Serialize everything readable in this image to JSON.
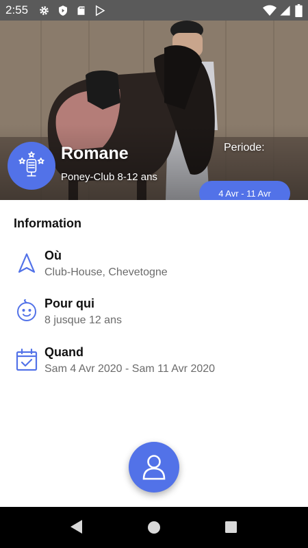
{
  "status_bar": {
    "time": "2:55",
    "left_icons": [
      "gear-icon",
      "shield-icon",
      "sd-card-icon",
      "play-store-icon"
    ],
    "right_icons": [
      "wifi-icon",
      "signal-icon",
      "battery-icon"
    ]
  },
  "hero": {
    "name": "Romane",
    "subtitle": "Poney-Club 8-12 ans",
    "periode_label": "Periode:",
    "periode_value": "4 Avr - 11 Avr",
    "avatar_icon": "award-mic-icon"
  },
  "information": {
    "title": "Information",
    "rows": [
      {
        "icon": "navigation-arrow-icon",
        "title": "Où",
        "value": "Club-House, Chevetogne"
      },
      {
        "icon": "baby-face-icon",
        "title": "Pour qui",
        "value": "8 jusque 12 ans"
      },
      {
        "icon": "calendar-check-icon",
        "title": "Quand",
        "value": "Sam 4 Avr 2020 - Sam 11 Avr 2020"
      }
    ]
  },
  "fab": {
    "icon": "user-icon"
  },
  "nav_bar": {
    "icons": [
      "back-icon",
      "home-icon",
      "recents-icon"
    ]
  },
  "colors": {
    "accent": "#5272e8",
    "status_bar": "#5a5a5a",
    "nav_bar": "#000000"
  }
}
